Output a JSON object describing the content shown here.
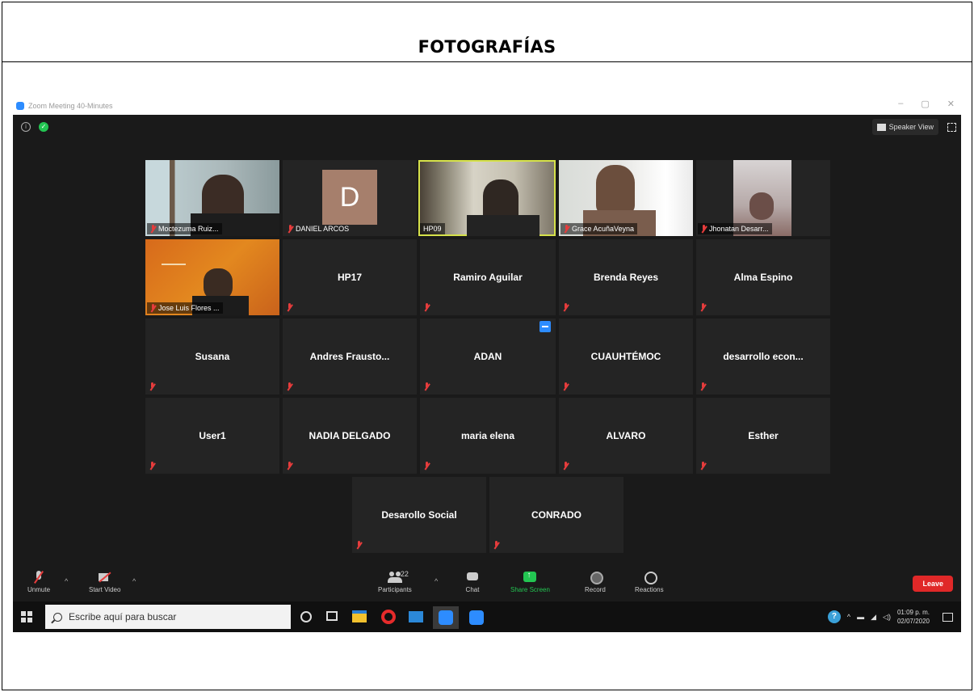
{
  "document": {
    "heading": "FOTOGRAFÍAS"
  },
  "window": {
    "title": "Zoom Meeting 40-Minutes",
    "controls": [
      "–",
      "▢",
      "✕"
    ]
  },
  "topbar": {
    "speaker_view_label": "Speaker View"
  },
  "tiles": [
    {
      "name": "Moctezuma Ruiz...",
      "type": "video"
    },
    {
      "name": "DANIEL ARCOS",
      "type": "avatar",
      "initial": "D"
    },
    {
      "name": "HP09",
      "type": "video",
      "active": true
    },
    {
      "name": "Grace AcuñaVeyna",
      "type": "video"
    },
    {
      "name": "Jhonatan Desarr...",
      "type": "video"
    },
    {
      "name": "Jose Luis Flores ...",
      "type": "video"
    },
    {
      "name": "HP17",
      "type": "name"
    },
    {
      "name": "Ramiro Aguilar",
      "type": "name"
    },
    {
      "name": "Brenda Reyes",
      "type": "name"
    },
    {
      "name": "Alma Espino",
      "type": "name"
    },
    {
      "name": "Susana",
      "type": "name"
    },
    {
      "name": "Andres Frausto...",
      "type": "name"
    },
    {
      "name": "ADAN",
      "type": "name",
      "chat_flag": true
    },
    {
      "name": "CUAUHTÉMOC",
      "type": "name"
    },
    {
      "name": "desarrollo econ...",
      "type": "name"
    },
    {
      "name": "User1",
      "type": "name"
    },
    {
      "name": "NADIA DELGADO",
      "type": "name"
    },
    {
      "name": "maria elena",
      "type": "name"
    },
    {
      "name": "ALVARO",
      "type": "name"
    },
    {
      "name": "Esther",
      "type": "name"
    },
    {
      "name": "Desarollo Social",
      "type": "name"
    },
    {
      "name": "CONRADO",
      "type": "name"
    }
  ],
  "toolbar": {
    "unmute": "Unmute",
    "start_video": "Start Video",
    "participants": "Participants",
    "participants_count": "22",
    "chat": "Chat",
    "share_screen": "Share Screen",
    "record": "Record",
    "reactions": "Reactions",
    "leave": "Leave"
  },
  "taskbar": {
    "search_placeholder": "Escribe aquí para buscar",
    "time": "01:09 p. m.",
    "date": "02/07/2020"
  },
  "colors": {
    "zoom_bg": "#1a1a1a",
    "tile_bg": "#242424",
    "active_border": "#d6e24a",
    "leave": "#e02828",
    "share": "#23c552",
    "zoom_blue": "#2d8cff"
  }
}
